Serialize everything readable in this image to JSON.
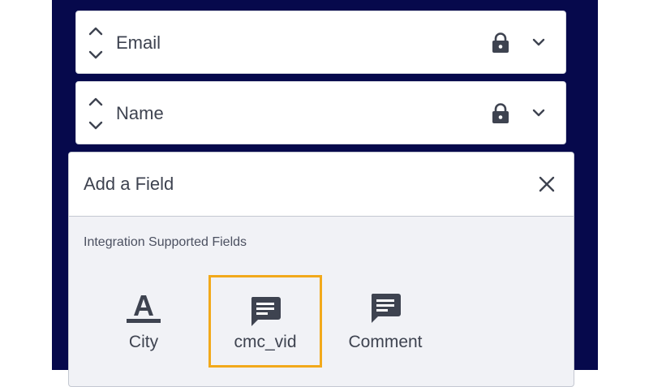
{
  "form_fields": [
    {
      "label": "Email",
      "icons": [
        "sort-icon",
        "lock-icon",
        "chevron-down-icon"
      ]
    },
    {
      "label": "Name",
      "icons": [
        "sort-icon",
        "lock-icon",
        "chevron-down-icon"
      ]
    }
  ],
  "add_field_modal": {
    "title": "Add a Field",
    "section_label": "Integration Supported Fields",
    "options": [
      {
        "label": "City",
        "icon": "text-field-icon"
      },
      {
        "label": "cmc_vid",
        "icon": "comment-icon",
        "highlighted": true
      },
      {
        "label": "Comment",
        "icon": "comment-icon"
      }
    ]
  },
  "colors": {
    "panel_background": "#06094c",
    "highlight": "#f2a91b",
    "icon": "#3e4350"
  }
}
